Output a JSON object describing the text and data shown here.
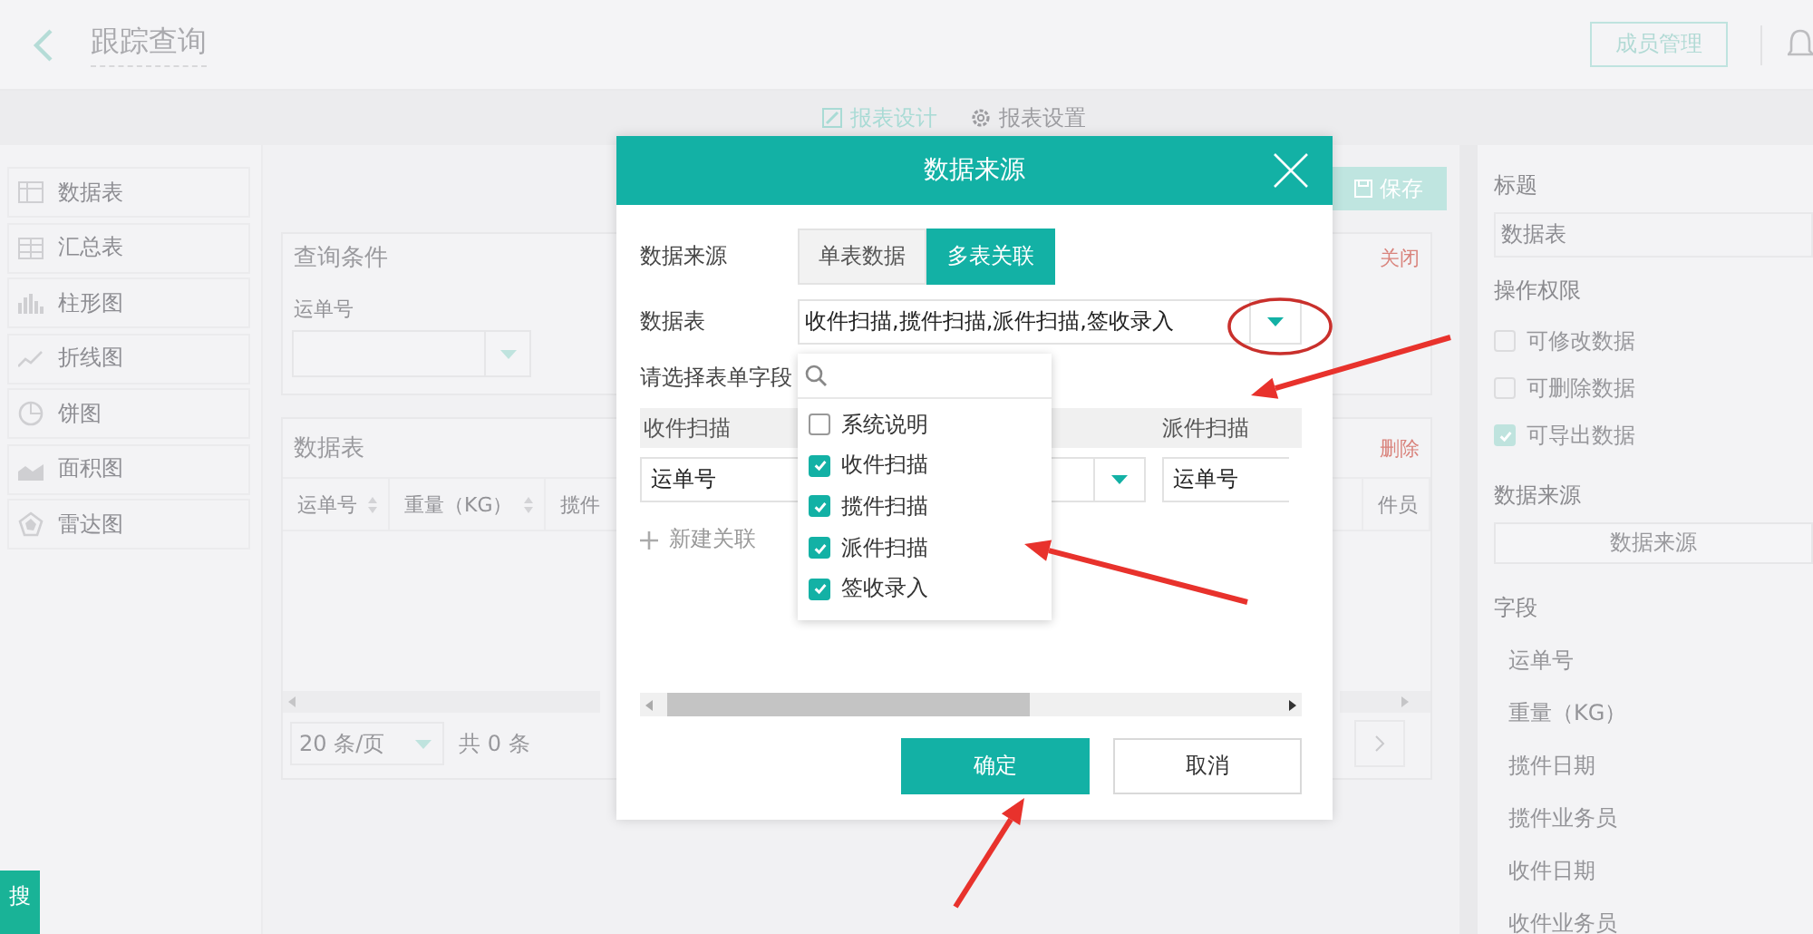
{
  "header": {
    "title": "跟踪查询",
    "member_button": "成员管理"
  },
  "design_tabs": [
    {
      "label": "报表设计",
      "selected": true,
      "kind": "pencil"
    },
    {
      "label": "报表设置",
      "selected": false,
      "kind": "gear"
    }
  ],
  "sidebar": {
    "items": [
      {
        "label": "数据表",
        "kind": "table"
      },
      {
        "label": "汇总表",
        "kind": "summary"
      },
      {
        "label": "柱形图",
        "kind": "bar"
      },
      {
        "label": "折线图",
        "kind": "line"
      },
      {
        "label": "饼图",
        "kind": "pie"
      },
      {
        "label": "面积图",
        "kind": "area"
      },
      {
        "label": "雷达图",
        "kind": "radar"
      }
    ]
  },
  "search_tab": "搜",
  "save_button": "保存",
  "query_card": {
    "title": "查询条件",
    "close": "关闭",
    "field_label": "运单号"
  },
  "table_card": {
    "title": "数据表",
    "delete": "删除",
    "columns": [
      "运单号",
      "重量（KG）",
      "揽件"
    ],
    "columns_right": [
      "件员"
    ],
    "page_size": "20 条/页",
    "total": "共 0 条"
  },
  "properties": {
    "title_label": "标题",
    "title_value": "数据表",
    "permissions_label": "操作权限",
    "permissions": [
      {
        "label": "可修改数据",
        "checked": false
      },
      {
        "label": "可删除数据",
        "checked": false
      },
      {
        "label": "可导出数据",
        "checked": true
      }
    ],
    "source_label": "数据来源",
    "source_button": "数据来源",
    "fields_label": "字段",
    "fields": [
      "运单号",
      "重量（KG）",
      "揽件日期",
      "揽件业务员",
      "收件日期",
      "收件业务员"
    ]
  },
  "dialog": {
    "title": "数据来源",
    "source_label": "数据来源",
    "source_modes": [
      {
        "label": "单表数据",
        "selected": false
      },
      {
        "label": "多表关联",
        "selected": true
      }
    ],
    "table_label": "数据表",
    "table_value": "收件扫描,揽件扫描,派件扫描,签收录入",
    "field_hint": "请选择表单字段",
    "relation_columns": [
      "收件扫描",
      "派件扫描"
    ],
    "relation_values": [
      "运单号",
      "运单号"
    ],
    "new_relation": "新建关联",
    "ok": "确定",
    "cancel": "取消",
    "options": [
      {
        "label": "系统说明",
        "checked": false
      },
      {
        "label": "收件扫描",
        "checked": true
      },
      {
        "label": "揽件扫描",
        "checked": true
      },
      {
        "label": "派件扫描",
        "checked": true
      },
      {
        "label": "签收录入",
        "checked": true
      }
    ]
  }
}
